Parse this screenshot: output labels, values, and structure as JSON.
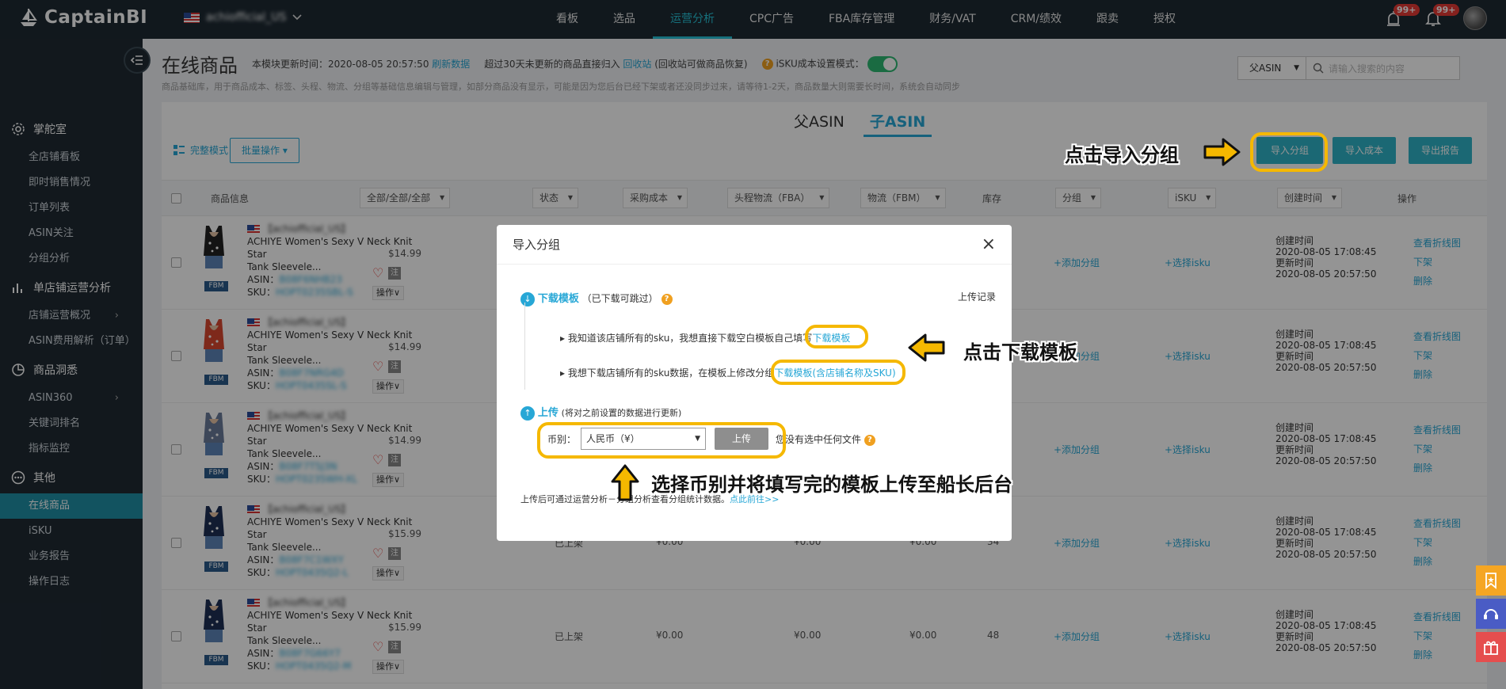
{
  "app": {
    "logo": "CaptainBI",
    "store": "achiofficial_US"
  },
  "nav": [
    "看板",
    "选品",
    "运营分析",
    "CPC广告",
    "FBA库存管理",
    "财务/VAT",
    "CRM/绩效",
    "跟卖",
    "授权"
  ],
  "badges": {
    "alert": "99+",
    "bell": "99+"
  },
  "sidebar": {
    "groups": [
      {
        "label": "掌舵室",
        "icon": "gear-icon",
        "items": [
          "全店铺看板",
          "即时销售情况",
          "订单列表",
          "ASIN关注",
          "分组分析"
        ]
      },
      {
        "label": "单店铺运营分析",
        "icon": "bar-chart-icon",
        "items": [
          "店铺运营概况",
          "ASIN费用解析（订单）"
        ]
      },
      {
        "label": "商品洞悉",
        "icon": "pie-icon",
        "items": [
          "ASIN360",
          "关键词排名",
          "指标监控"
        ]
      },
      {
        "label": "其他",
        "icon": "more-icon",
        "items": [
          "在线商品",
          "iSKU",
          "业务报告",
          "操作日志"
        ]
      }
    ],
    "active": "在线商品"
  },
  "page": {
    "title": "在线商品",
    "update_label": "本模块更新时间：2020-08-05 20:57:50",
    "refresh": "刷新数据",
    "recycle_text": "超过30天未更新的商品直接归入",
    "recycle_link": "回收站",
    "recycle_note": "(回收站可做商品恢复)",
    "isku_mode": "iSKU成本设置模式：",
    "description": "商品基础库，用于商品成本、标签、头程、物流、分组等基础信息编辑与管理，如部分商品没有显示，可能是因为您后台已经下架或者还没同步过来，请等待1-2天，商品数量大则需要长时间，系统会自动同步"
  },
  "search": {
    "select": "父ASIN",
    "placeholder": "请输入搜索的内容"
  },
  "tabs": [
    "父ASIN",
    "子ASIN"
  ],
  "toolbar": {
    "mode": "完整模式",
    "batch": "批量操作",
    "import_group": "导入分组",
    "import_cost": "导入成本",
    "export": "导出报告"
  },
  "table": {
    "headers": {
      "product": "商品信息",
      "filter": "全部/全部/全部",
      "status": "状态",
      "purchase": "采购成本",
      "first_leg": "头程物流（FBA）",
      "logistics": "物流（FBM）",
      "stock": "库存",
      "group": "分组",
      "isku": "iSKU",
      "created": "创建时间",
      "ops": "操作"
    },
    "rows": [
      {
        "shop": "【achiofficial_US】",
        "title1": "ACHIYE Women's Sexy V Neck Knit Star",
        "title2": "Tank Sleevele...",
        "price": "$14.99",
        "asin": "B08F6NHB23",
        "sku": "HOPT0235SBL-S",
        "status": "",
        "purchase": "",
        "first": "",
        "fbm": "",
        "stock": "",
        "created": "2020-08-05 17:08:45",
        "updated": "2020-08-05 20:57:50"
      },
      {
        "shop": "【achiofficial_US】",
        "title1": "ACHIYE Women's Sexy V Neck Knit Star",
        "title2": "Tank Sleevele...",
        "price": "$14.99",
        "asin": "B08F7NRG4D",
        "sku": "HOPT0435SL-S",
        "status": "",
        "purchase": "",
        "first": "",
        "fbm": "",
        "stock": "",
        "created": "2020-08-05 17:08:45",
        "updated": "2020-08-05 20:57:50"
      },
      {
        "shop": "【achiofficial_US】",
        "title1": "ACHIYE Women's Sexy V Neck Knit Star",
        "title2": "Tank Sleevele...",
        "price": "$14.99",
        "asin": "B08F7T5J3N",
        "sku": "HOPT0235WH-XL",
        "status": "",
        "purchase": "",
        "first": "",
        "fbm": "",
        "stock": "",
        "created": "2020-08-05 17:08:45",
        "updated": "2020-08-05 20:57:50"
      },
      {
        "shop": "【achiofficial_US】",
        "title1": "ACHIYE Women's Sexy V Neck Knit Star",
        "title2": "Tank Sleevele...",
        "price": "$15.99",
        "asin": "B08F7C1WXY",
        "sku": "HOPT0435Q2-L",
        "status": "已上架",
        "purchase": "¥0.00",
        "first": "¥0.00",
        "fbm": "¥0.00",
        "stock": "34",
        "created": "2020-08-05 17:08:45",
        "updated": "2020-08-05 20:57:50"
      },
      {
        "shop": "【achiofficial_US】",
        "title1": "ACHIYE Women's Sexy V Neck Knit Star",
        "title2": "Tank Sleevele...",
        "price": "$15.99",
        "asin": "B08F7G66Y7",
        "sku": "HOPT0435Q2-M",
        "status": "已上架",
        "purchase": "¥0.00",
        "first": "¥0.00",
        "fbm": "¥0.00",
        "stock": "48",
        "created": "2020-08-05 17:08:45",
        "updated": "2020-08-05 20:57:50"
      }
    ],
    "labels": {
      "asin": "ASIN：",
      "sku": "SKU：",
      "fbm": "FBM",
      "op": "操作",
      "note": "注",
      "add_group": "+添加分组",
      "select_isku": "+选择isku",
      "created_label": "创建时间",
      "updated_label": "更新时间",
      "trend": "查看折线图",
      "off": "下架",
      "del": "删除"
    }
  },
  "modal": {
    "title": "导入分组",
    "step1": "下载模板",
    "step1_note": "（已下载可跳过）",
    "upload_log": "上传记录",
    "line1": "我知道该店铺所有的sku，我想直接下载空白模板自己填写",
    "link1": "下载模板",
    "line2": "我想下载店铺所有的sku数据，在模板上修改分组",
    "link2": "下载模板(含店铺名称及SKU)",
    "step2": "上传",
    "step2_note": "(将对之前设置的数据进行更新)",
    "currency_label": "币别：",
    "currency": "人民币（¥）",
    "upload_btn": "上传",
    "no_file": "您没有选中任何文件",
    "footer": "上传后可通过运营分析－分组分析查看分组统计数据。",
    "footer_link": "点此前往>>"
  },
  "annotations": {
    "a1": "点击导入分组",
    "a2": "点击下载模板",
    "a3": "选择币别并将填写完的模板上传至船长后台"
  },
  "colors": {
    "accent": "#27a7d6",
    "teal": "#2fb4c8",
    "highlight": "#f5b800",
    "toggle": "#2eb872"
  }
}
